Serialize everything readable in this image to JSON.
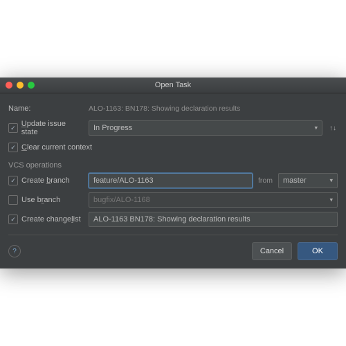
{
  "title": "Open Task",
  "name_label": "Name:",
  "name_value": "ALO-1163: BN178: Showing declaration results",
  "update_state_label": "Update issue state",
  "state_value": "In Progress",
  "clear_context_label": "Clear current context",
  "vcs_section": "VCS operations",
  "create_branch_label": "Create branch",
  "create_branch_value": "feature/ALO-1163",
  "from_label": "from",
  "from_value": "master",
  "use_branch_label": "Use branch",
  "use_branch_value": "bugfix/ALO-1168",
  "create_changelist_label": "Create changelist",
  "create_changelist_value": "ALO-1163 BN178: Showing declaration results",
  "cancel": "Cancel",
  "ok": "OK"
}
